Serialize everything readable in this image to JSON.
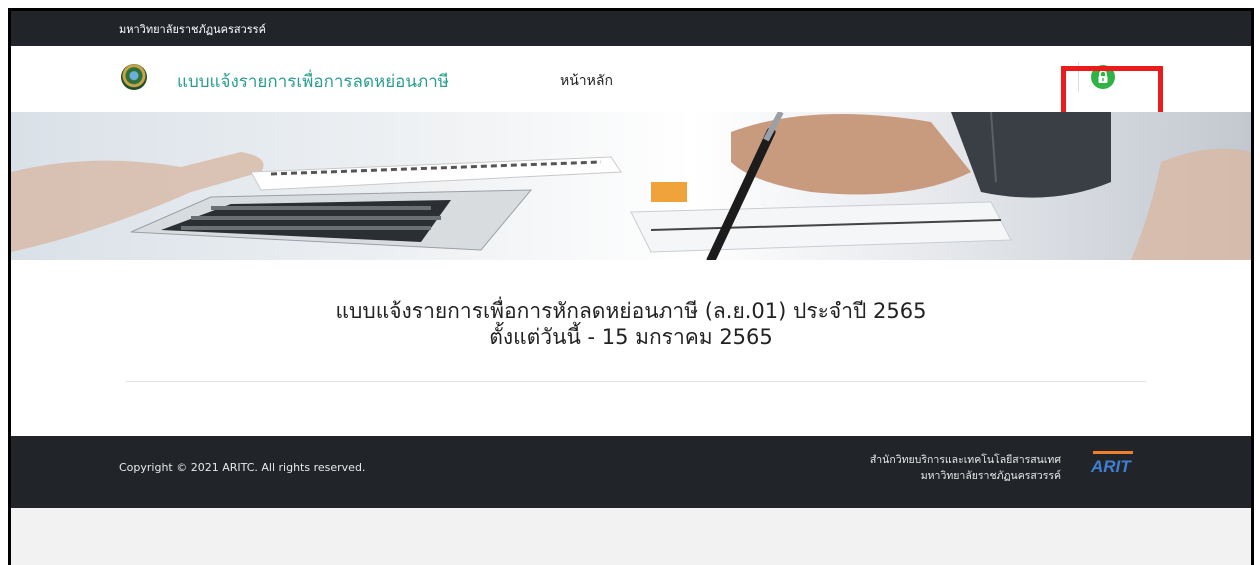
{
  "topbar": {
    "university": "มหาวิทยาลัยราชภัฏนครสวรรค์"
  },
  "nav": {
    "brand": "แบบแจ้งรายการเพื่อการลดหย่อนภาษี",
    "home": "หน้าหลัก",
    "login_icon": "lock-icon",
    "accent": "#2a9d8f",
    "login_color": "#2fb344"
  },
  "annotation": {
    "highlight_color": "#ea1b1b",
    "arrow_color": "#f07f2a"
  },
  "main": {
    "title_line1": "แบบแจ้งรายการเพื่อการหักลดหย่อนภาษี (ล.ย.01) ประจำปี 2565",
    "title_line2": "ตั้งแต่วันนี้ - 15 มกราคม 2565"
  },
  "footer": {
    "copyright": "Copyright © 2021 ARITC. All rights reserved.",
    "org_line1": "สำนักวิทยบริการและเทคโนโลยีสารสนเทศ",
    "org_line2": "มหาวิทยาลัยราชภัฏนครสวรรค์",
    "logo_text": "ARIT"
  }
}
